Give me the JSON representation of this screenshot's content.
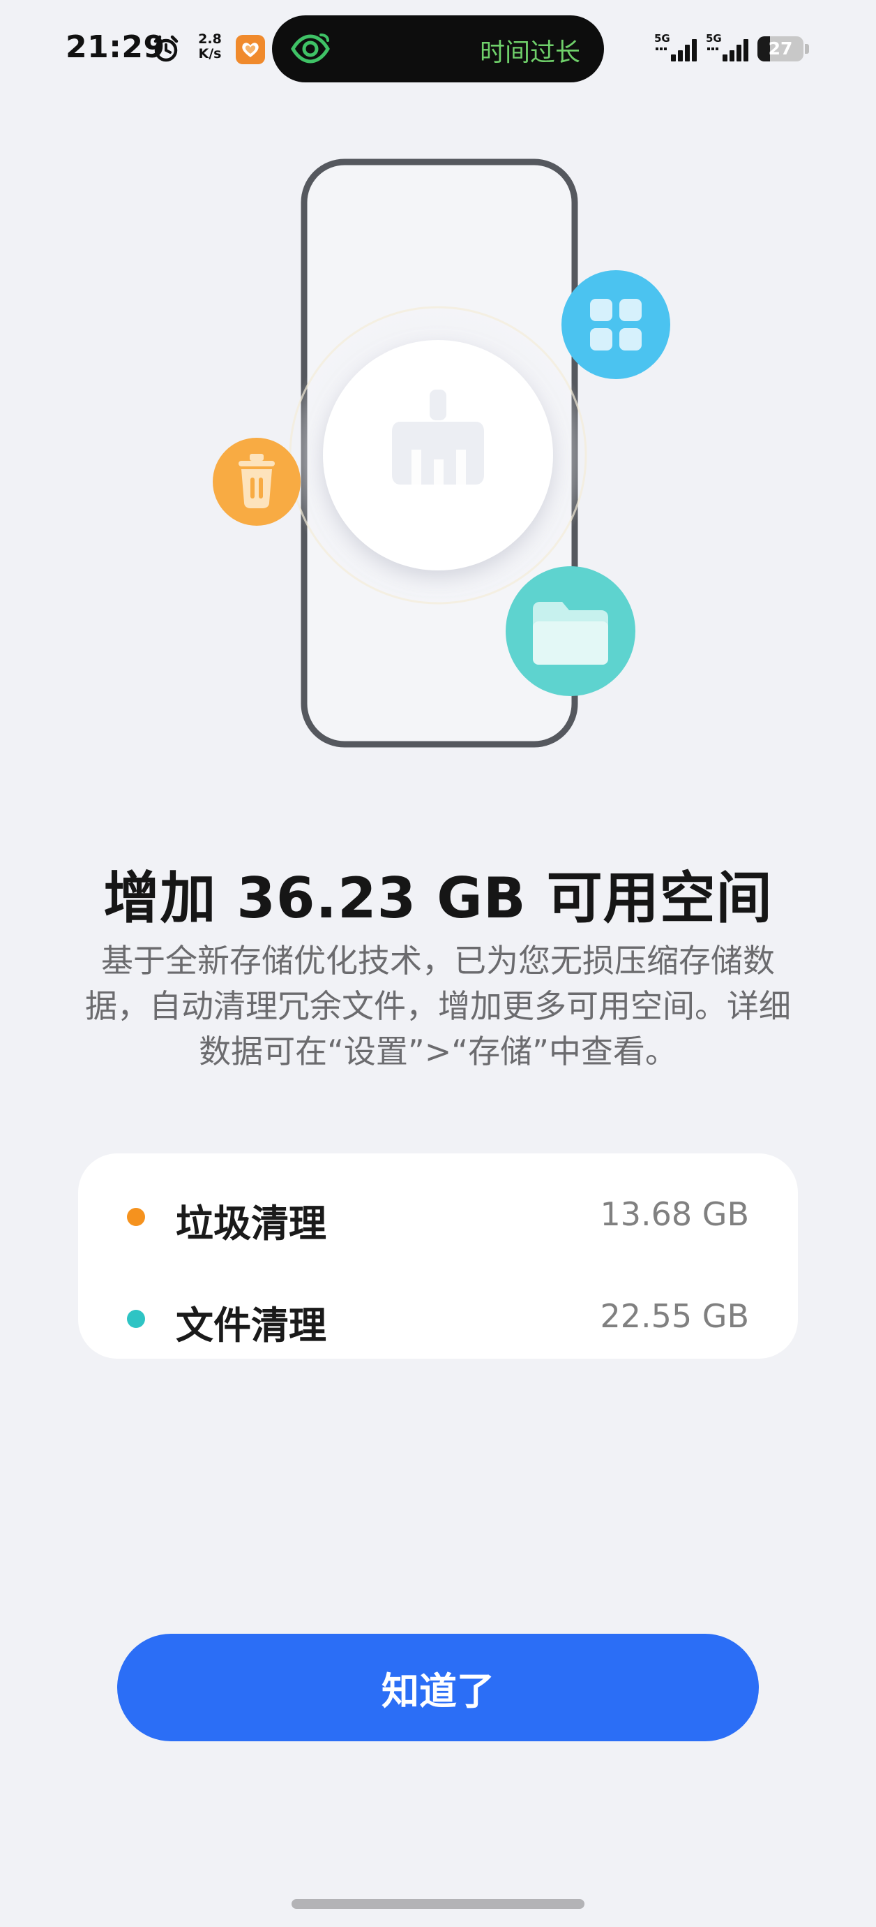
{
  "status_bar": {
    "time": "21:29",
    "net_speed_value": "2.8",
    "net_speed_unit": "K/s",
    "alarm_icon": "alarm-clock-icon",
    "app_icon": "health-heart-icon",
    "notification_pill": {
      "icon": "eye-care-icon",
      "text": "时间过长",
      "text_color": "#6fd06a"
    },
    "signal_1_label": "5G",
    "signal_2_label": "5G",
    "battery_level": "27",
    "battery_fraction": 0.27
  },
  "illustration": {
    "center_icon": "broom-cleaner-icon",
    "floating_icons": [
      {
        "name": "apps-grid-icon",
        "color": "#4bc3f0"
      },
      {
        "name": "trash-icon",
        "color": "#f8ab43"
      },
      {
        "name": "folder-icon",
        "color": "#5ed3cf"
      }
    ]
  },
  "headline": "增加 36.23 GB 可用空间",
  "description": "基于全新存储优化技术，已为您无损压缩存储数据，自动清理冗余文件，增加更多可用空间。详细数据可在“设置”>“存储”中查看。",
  "stats": [
    {
      "label": "垃圾清理",
      "value": "13.68 GB",
      "dot_color": "#f5921e"
    },
    {
      "label": "文件清理",
      "value": "22.55 GB",
      "dot_color": "#2ec4c4"
    }
  ],
  "button": {
    "label": "知道了",
    "color": "#2b6ef6"
  }
}
